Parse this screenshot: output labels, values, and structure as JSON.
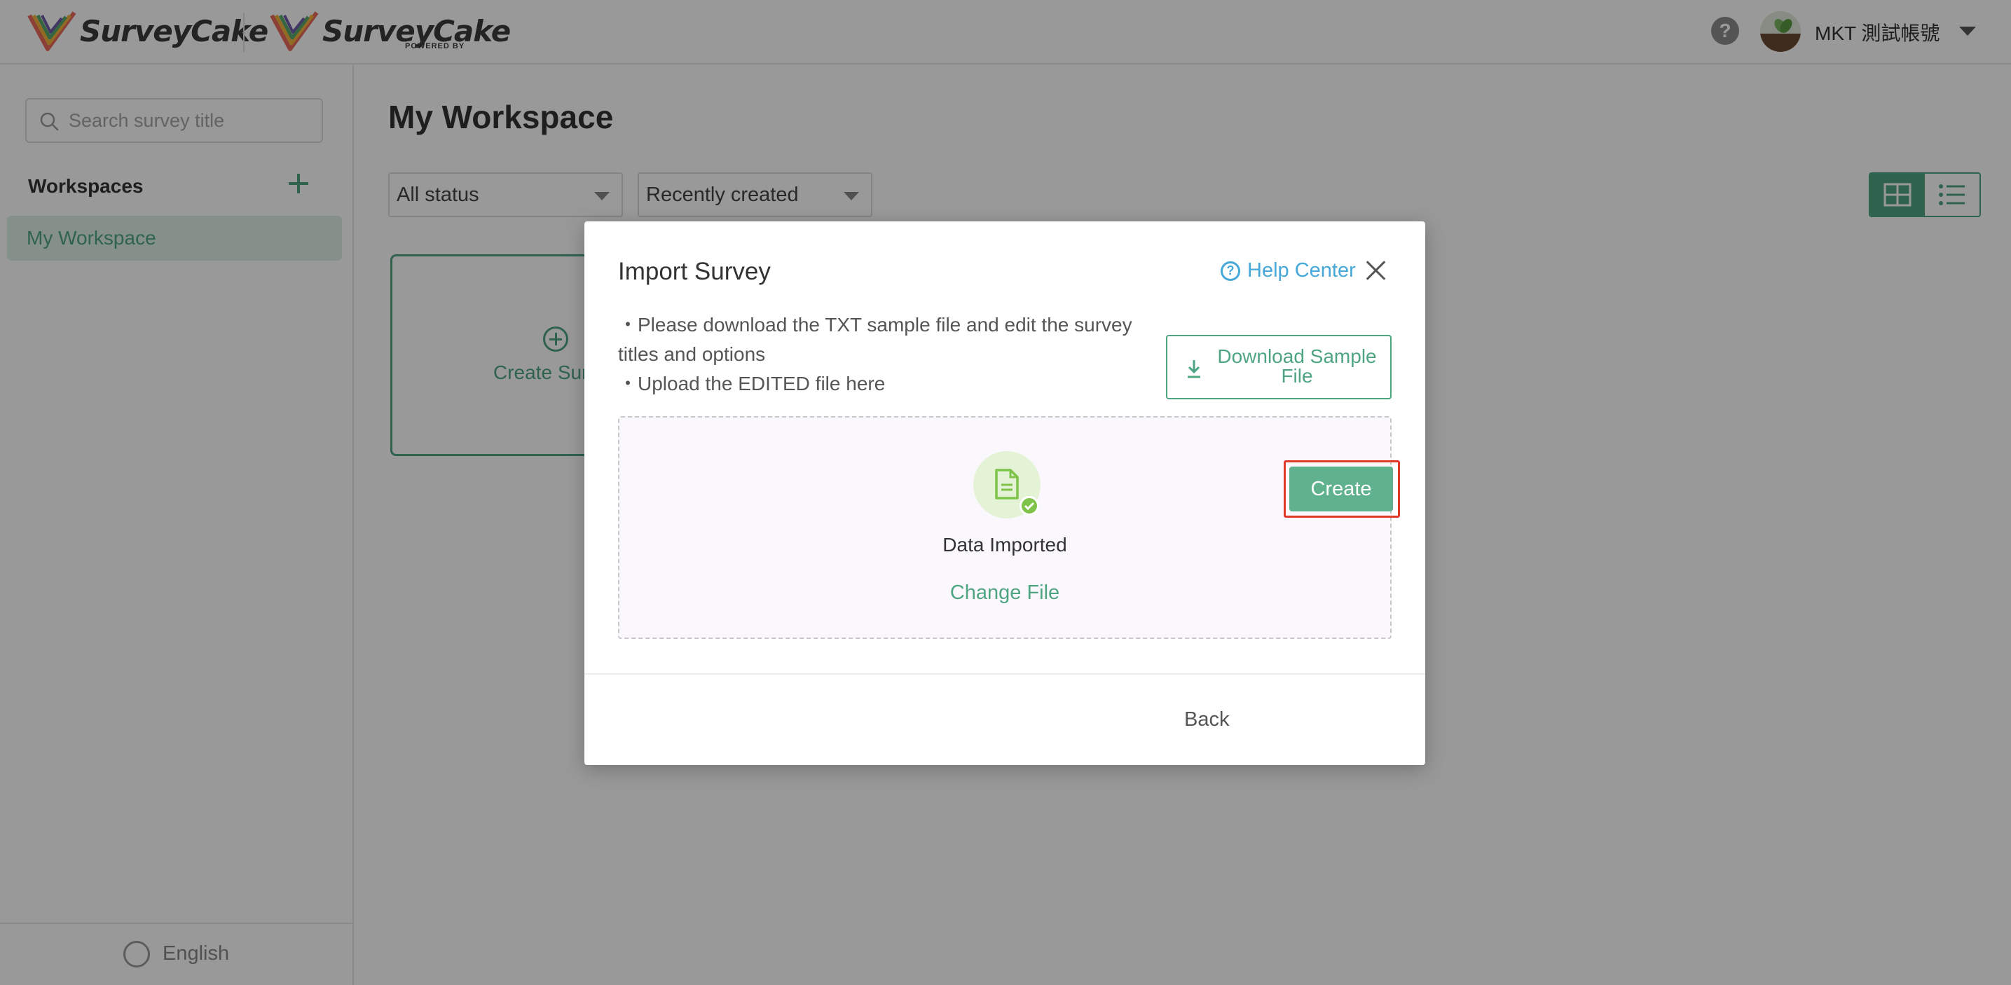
{
  "header": {
    "logo_primary": "SurveyCake",
    "logo_secondary": "SurveyCake",
    "logo_secondary_sub": "POWERED BY",
    "user_name": "MKT 測試帳號"
  },
  "sidebar": {
    "search_placeholder": "Search survey title",
    "workspaces_title": "Workspaces",
    "items": [
      {
        "label": "My Workspace",
        "active": true
      }
    ],
    "language": "English"
  },
  "main": {
    "title": "My Workspace",
    "status_filter": "All status",
    "sort_filter": "Recently created",
    "create_card_label": "Create Sur"
  },
  "modal": {
    "title": "Import Survey",
    "help_center": "Help Center",
    "instruction_1": "・Please download the TXT sample file and edit the survey titles and options",
    "instruction_2": "・Upload the EDITED file here",
    "download_button": "Download Sample File",
    "status": "Data Imported",
    "change_file": "Change File",
    "back_button": "Back",
    "create_button": "Create"
  },
  "colors": {
    "accent": "#4fa582",
    "link": "#46a7d9",
    "highlight": "#e0392b"
  }
}
